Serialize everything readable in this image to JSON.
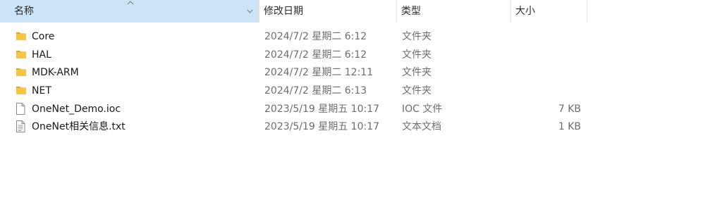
{
  "header": {
    "name": "名称",
    "date": "修改日期",
    "type": "类型",
    "size": "大小"
  },
  "files": [
    {
      "icon": "folder-icon",
      "name": "Core",
      "date": "2024/7/2 星期二 6:12",
      "type": "文件夹",
      "size": ""
    },
    {
      "icon": "folder-icon",
      "name": "HAL",
      "date": "2024/7/2 星期二 6:12",
      "type": "文件夹",
      "size": ""
    },
    {
      "icon": "folder-icon",
      "name": "MDK-ARM",
      "date": "2024/7/2 星期二 12:11",
      "type": "文件夹",
      "size": ""
    },
    {
      "icon": "folder-icon",
      "name": "NET",
      "date": "2024/7/2 星期二 6:13",
      "type": "文件夹",
      "size": ""
    },
    {
      "icon": "file-icon",
      "name": "OneNet_Demo.ioc",
      "date": "2023/5/19 星期五 10:17",
      "type": "IOC 文件",
      "size": "7 KB"
    },
    {
      "icon": "text-file-icon",
      "name": "OneNet相关信息.txt",
      "date": "2023/5/19 星期五 10:17",
      "type": "文本文档",
      "size": "1 KB"
    }
  ],
  "colors": {
    "header_selected": "#cce4f7",
    "folder": "#f8c441",
    "folder_dark": "#e3a82b"
  }
}
